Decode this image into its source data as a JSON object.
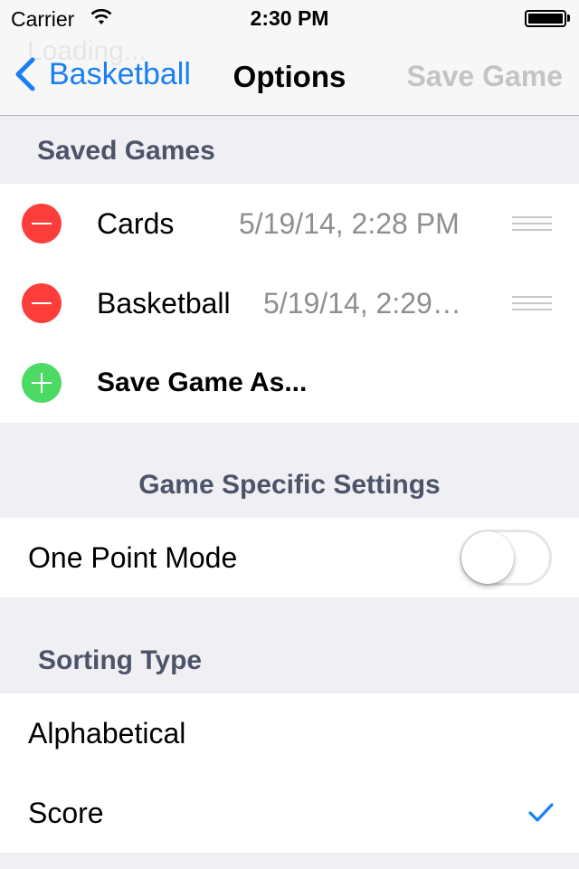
{
  "status_bar": {
    "carrier": "Carrier",
    "time": "2:30 PM",
    "battery_level": 1.0
  },
  "nav_bar": {
    "ghost_text": "Loading...",
    "back_label": "Basketball",
    "title": "Options",
    "right_button_label": "Save Game",
    "right_button_enabled": false
  },
  "colors": {
    "accent": "#1a7ff2",
    "delete_red": "#fc3d39",
    "insert_green": "#4cd964",
    "section_header": "#4d5468",
    "secondary_text": "#8e8e93",
    "background": "#efeff4"
  },
  "saved_games": {
    "header": "Saved Games",
    "items": [
      {
        "name": "Cards",
        "date": "5/19/14, 2:28 PM"
      },
      {
        "name": "Basketball",
        "date": "5/19/14, 2:29…"
      }
    ],
    "save_as_label": "Save Game As..."
  },
  "game_settings": {
    "header": "Game Specific Settings",
    "one_point_mode": {
      "label": "One Point Mode",
      "on": false
    }
  },
  "sorting": {
    "header": "Sorting Type",
    "options": [
      {
        "label": "Alphabetical",
        "selected": false
      },
      {
        "label": "Score",
        "selected": true
      }
    ]
  }
}
